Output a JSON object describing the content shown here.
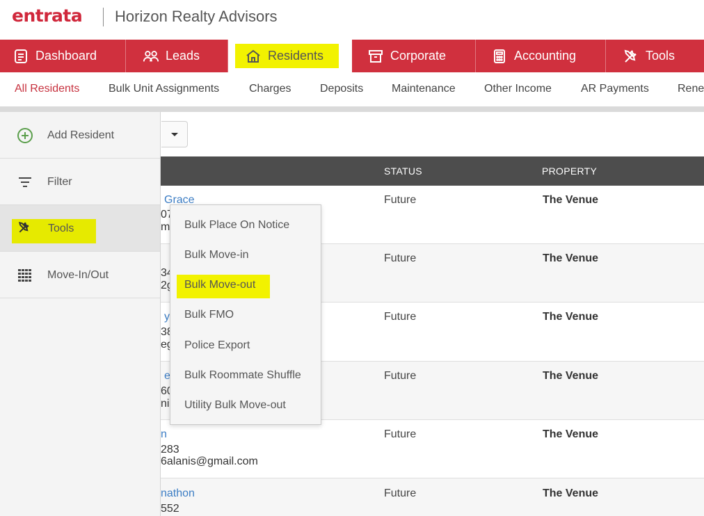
{
  "header": {
    "logo": "entrata",
    "company": "Horizon Realty Advisors"
  },
  "main_nav": {
    "tabs": [
      {
        "label": "Dashboard",
        "icon": "clipboard-icon"
      },
      {
        "label": "Leads",
        "icon": "people-icon"
      },
      {
        "label": "Residents",
        "icon": "house-icon",
        "active": true
      },
      {
        "label": "Corporate",
        "icon": "archive-box-icon"
      },
      {
        "label": "Accounting",
        "icon": "calculator-icon"
      },
      {
        "label": "Tools",
        "icon": "wrench-screwdriver-icon"
      }
    ],
    "bg_color": "#d0303e"
  },
  "sub_nav": {
    "items": [
      "All Residents",
      "Bulk Unit Assignments",
      "Charges",
      "Deposits",
      "Maintenance",
      "Other Income",
      "AR Payments",
      "Rene"
    ],
    "active": "All Residents"
  },
  "side_menu": {
    "items": [
      {
        "label": "Add Resident",
        "icon": "plus-circle-icon"
      },
      {
        "label": "Filter",
        "icon": "filter-lines-icon"
      },
      {
        "label": "Tools",
        "icon": "wrench-screwdriver-icon",
        "active": true
      },
      {
        "label": "Move-In/Out",
        "icon": "grid-icon"
      }
    ]
  },
  "tools_dropdown": {
    "items": [
      "Bulk Place On Notice",
      "Bulk Move-in",
      "Bulk Move-out",
      "Bulk FMO",
      "Police Export",
      "Bulk Roommate Shuffle",
      "Utility Bulk Move-out"
    ],
    "highlighted": "Bulk Move-out"
  },
  "table": {
    "columns": [
      "STATUS",
      "PROPERTY"
    ],
    "rows": [
      {
        "name": "Grace",
        "line2": "07",
        "line3": "m",
        "status": "Future",
        "property": "The Venue"
      },
      {
        "name": "",
        "line2": "34",
        "line3": "2g",
        "status": "Future",
        "property": "The Venue"
      },
      {
        "name": "yl",
        "line2": "38",
        "line3": "eg",
        "status": "Future",
        "property": "The Venue"
      },
      {
        "name": "el",
        "line2": "60",
        "line3": "ni",
        "status": "Future",
        "property": "The Venue"
      },
      {
        "name": "n",
        "line2": "283",
        "line3": "6alanis@gmail.com",
        "status": "Future",
        "property": "The Venue"
      },
      {
        "name": "nathon",
        "line2": "552",
        "line3": "",
        "status": "Future",
        "property": "The Venue"
      }
    ]
  },
  "colors": {
    "brand_red": "#d0273b",
    "highlight_yellow": "#f2f200",
    "link_blue": "#3c7dc4",
    "table_header": "#4d4d4d"
  }
}
